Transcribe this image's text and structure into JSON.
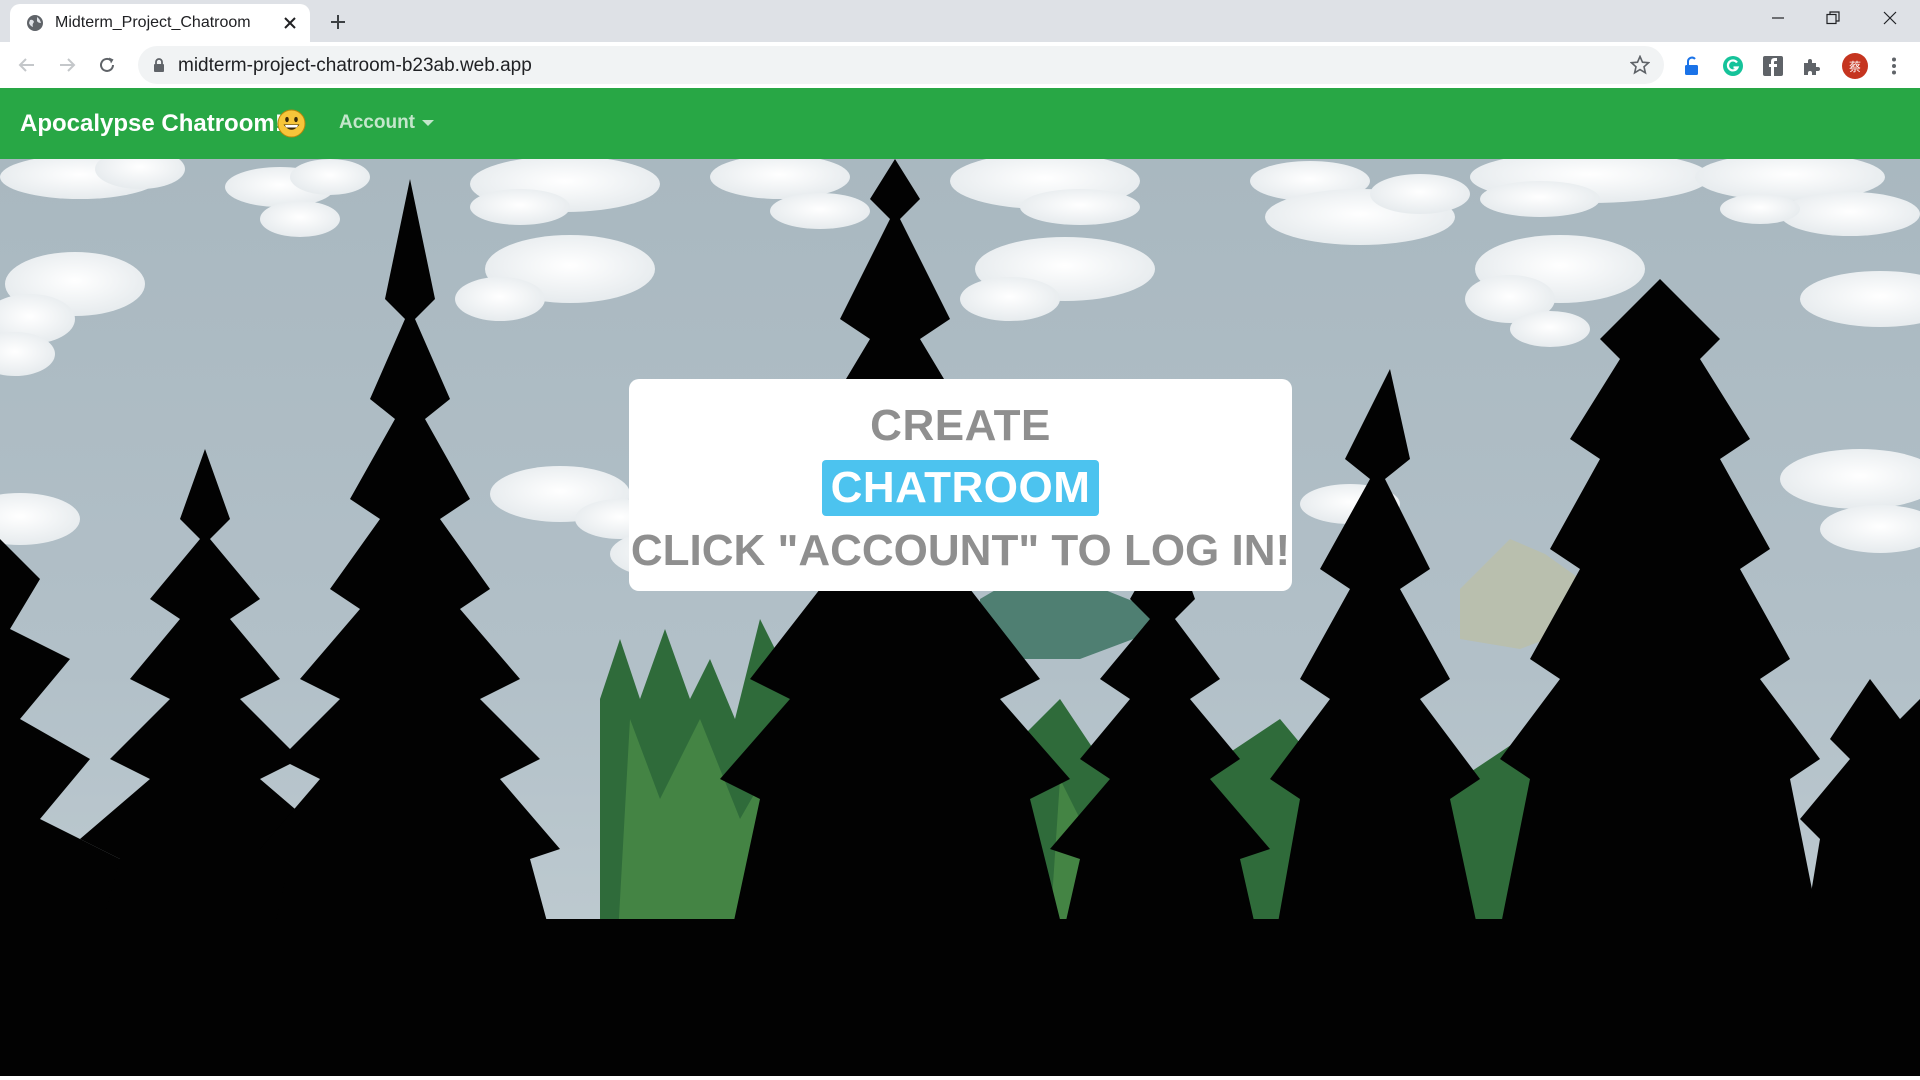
{
  "browser": {
    "tab": {
      "title": "Midterm_Project_Chatroom",
      "favicon": "globe-icon"
    },
    "new_tab": "plus-icon",
    "window_controls": [
      "minimize-icon",
      "restore-icon",
      "close-icon"
    ],
    "toolbar": {
      "back": "back-arrow-icon",
      "forward": "forward-arrow-icon",
      "reload": "reload-icon",
      "url": "midterm-project-chatroom-b23ab.web.app",
      "lock": "lock-icon",
      "bookmark": "star-icon"
    },
    "extensions": [
      "shield-extension-icon",
      "grammarly-icon",
      "facebook-icon",
      "puzzle-extensions-icon",
      "profile-avatar",
      "more-menu-icon"
    ],
    "profile_initial": "蔡"
  },
  "navbar": {
    "brand": "Apocalypse Chatroom!",
    "brand_emoji": "grinning-face-icon",
    "account_menu": "Account",
    "color": "#28a745"
  },
  "card": {
    "line1": "CREATE",
    "button": "CHATROOM",
    "line3": "CLICK \"ACCOUNT\" TO LOG IN!",
    "button_color": "#4cc3ef",
    "text_color": "#8f8f8f"
  }
}
